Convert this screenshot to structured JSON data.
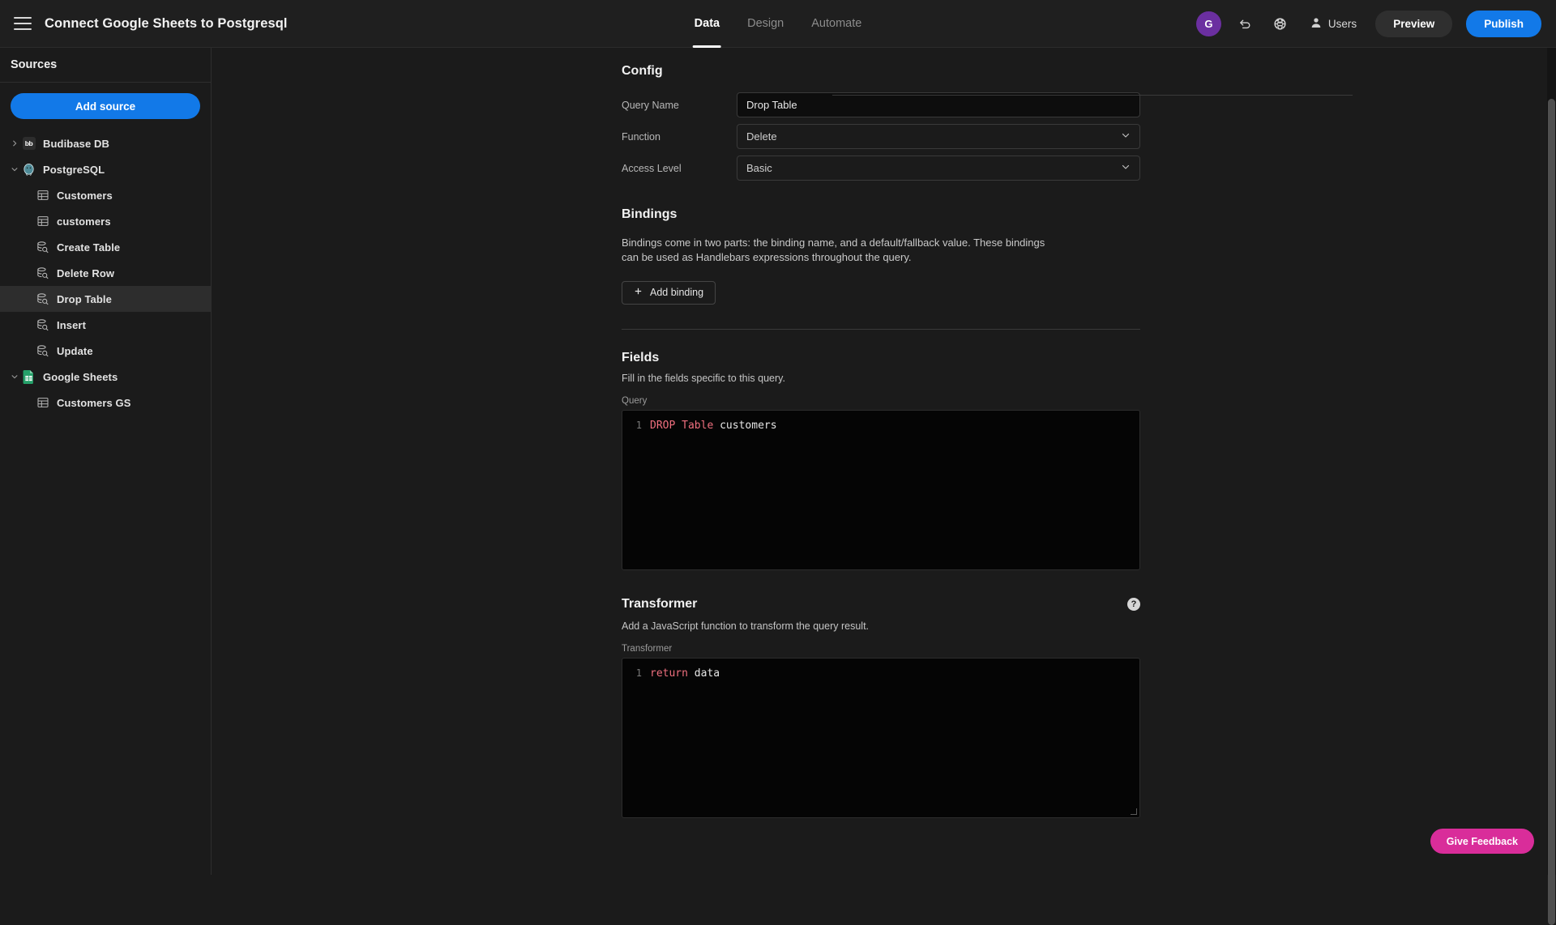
{
  "topbar": {
    "menu_icon": "hamburger-icon",
    "title": "Connect Google Sheets to Postgresql",
    "tabs": [
      {
        "label": "Data",
        "active": true
      },
      {
        "label": "Design",
        "active": false
      },
      {
        "label": "Automate",
        "active": false
      }
    ],
    "avatar_initial": "G",
    "avatar_color": "#6b2fa0",
    "undo_icon": "undo-icon",
    "globe_icon": "globe-icon",
    "users_icon": "user-icon",
    "users_label": "Users",
    "preview_label": "Preview",
    "publish_label": "Publish",
    "publish_color": "#1279e8"
  },
  "sidebar": {
    "header": "Sources",
    "add_source_label": "Add source",
    "items": [
      {
        "label": "Budibase DB",
        "icon": "budibase-db-icon",
        "depth": 0,
        "chevron": "right",
        "selected": false
      },
      {
        "label": "PostgreSQL",
        "icon": "postgresql-icon",
        "depth": 0,
        "chevron": "down",
        "selected": false
      },
      {
        "label": "Customers",
        "icon": "table-icon",
        "depth": 1,
        "chevron": "none",
        "selected": false
      },
      {
        "label": "customers",
        "icon": "table-icon",
        "depth": 1,
        "chevron": "none",
        "selected": false
      },
      {
        "label": "Create Table",
        "icon": "query-icon",
        "depth": 1,
        "chevron": "none",
        "selected": false
      },
      {
        "label": "Delete Row",
        "icon": "query-icon",
        "depth": 1,
        "chevron": "none",
        "selected": false
      },
      {
        "label": "Drop Table",
        "icon": "query-icon",
        "depth": 1,
        "chevron": "none",
        "selected": true
      },
      {
        "label": "Insert",
        "icon": "query-icon",
        "depth": 1,
        "chevron": "none",
        "selected": false
      },
      {
        "label": "Update",
        "icon": "query-icon",
        "depth": 1,
        "chevron": "none",
        "selected": false
      },
      {
        "label": "Google Sheets",
        "icon": "google-sheets-icon",
        "depth": 0,
        "chevron": "down",
        "selected": false
      },
      {
        "label": "Customers GS",
        "icon": "table-icon",
        "depth": 1,
        "chevron": "none",
        "selected": false
      }
    ]
  },
  "config": {
    "title": "Config",
    "query_name_label": "Query Name",
    "query_name_value": "Drop Table",
    "function_label": "Function",
    "function_value": "Delete",
    "access_level_label": "Access Level",
    "access_level_value": "Basic"
  },
  "bindings": {
    "title": "Bindings",
    "description": "Bindings come in two parts: the binding name, and a default/fallback value. These bindings can be used as Handlebars expressions throughout the query.",
    "add_binding_label": "Add binding",
    "add_binding_icon": "plus-icon"
  },
  "fields": {
    "title": "Fields",
    "description": "Fill in the fields specific to this query.",
    "query_label": "Query",
    "query_line_no": "1",
    "query_kw1": "DROP",
    "query_kw2": "Table",
    "query_rest": " customers"
  },
  "transformer": {
    "title": "Transformer",
    "help_icon": "question-circle-icon",
    "description": "Add a JavaScript function to transform the query result.",
    "editor_label": "Transformer",
    "line_no": "1",
    "kw": "return",
    "rest": " data"
  },
  "feedback": {
    "label": "Give Feedback",
    "color": "#d92d9a"
  }
}
